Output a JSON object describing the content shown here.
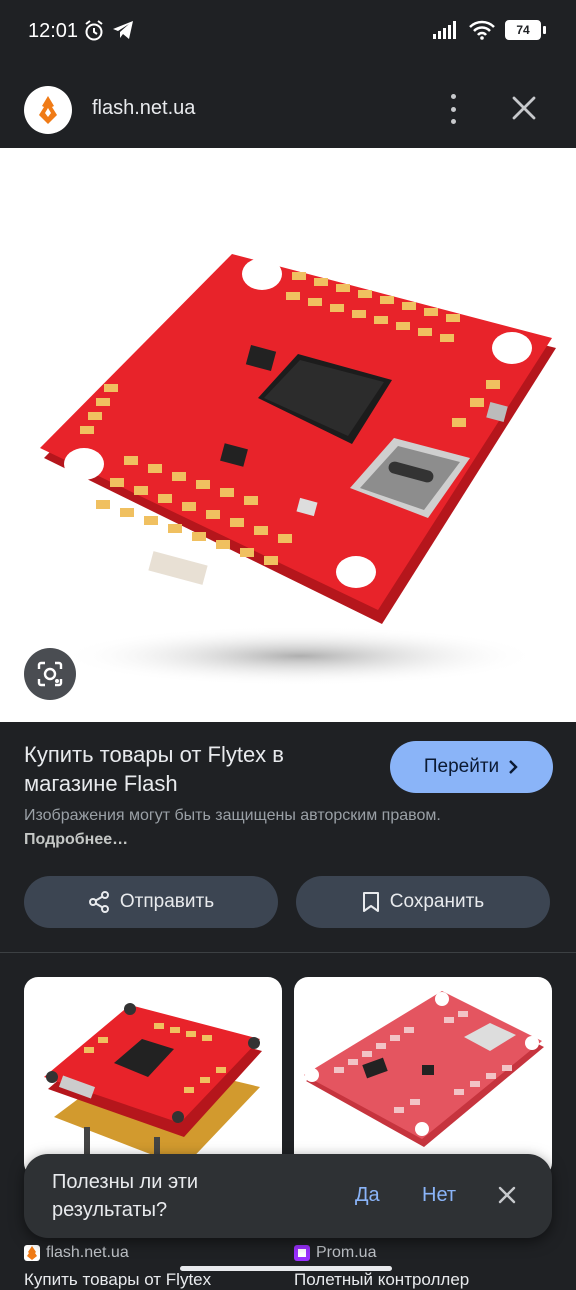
{
  "status_bar": {
    "time": "12:01",
    "battery": "74"
  },
  "app_bar": {
    "site": "flash.net.ua"
  },
  "result": {
    "title": "Купить товары от Flytex в магазине Flash",
    "visit_label": "Перейти",
    "notice_text": "Изображения могут быть защищены авторским правом.",
    "notice_more": "Подробнее…"
  },
  "actions": {
    "share_label": "Отправить",
    "save_label": "Сохранить"
  },
  "related": [
    {
      "source": "flash.net.ua",
      "caption": "Купить товары от Flytex"
    },
    {
      "source": "Prom.ua",
      "caption": "Полетный контроллер"
    }
  ],
  "feedback": {
    "question": "Полезны ли эти результаты?",
    "yes": "Да",
    "no": "Нет"
  },
  "colors": {
    "accent": "#8ab4f8",
    "pcb_red": "#e8232a",
    "pad_gold": "#f0c060"
  }
}
